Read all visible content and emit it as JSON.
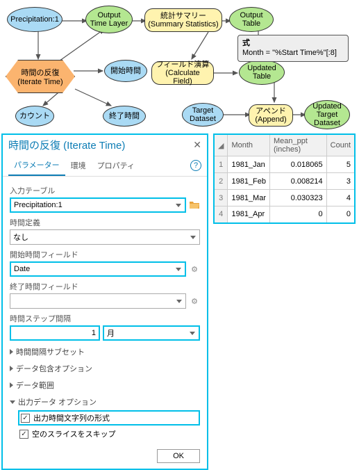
{
  "diagram": {
    "precipitation": "Precipitation:1",
    "output_time_layer": "Output Time Layer",
    "summary_stats": "統計サマリー (Summary Statistics)",
    "output_table": "Output Table",
    "iterate_hex": "時間の反復 (Iterate Time)",
    "start_time": "開始時間",
    "calc_field": "フィールド演算 (Calculate Field)",
    "updated_table": "Updated Table",
    "count": "カウント",
    "end_time": "終了時間",
    "target_dataset": "Target Dataset",
    "append": "アペンド (Append)",
    "updated_target": "Updated Target Dataset",
    "tooltip_title": "式",
    "tooltip_expr": "Month = \"%Start Time%\"[:8]"
  },
  "panel": {
    "title": "時間の反復 (Iterate Time)",
    "tabs": {
      "params": "パラメーター",
      "env": "環境",
      "props": "プロパティ"
    },
    "labels": {
      "input_table": "入力テーブル",
      "time_def": "時間定義",
      "start_field": "開始時間フィールド",
      "end_field": "終了時間フィールド",
      "step": "時間ステップ間隔"
    },
    "values": {
      "input_table": "Precipitation:1",
      "time_def": "なし",
      "start_field": "Date",
      "end_field": "",
      "step_num": "1",
      "step_unit": "月"
    },
    "sections": {
      "subset": "時間間隔サブセット",
      "inclusion": "データ包含オプション",
      "extent": "データ範囲",
      "output": "出力データ オプション"
    },
    "checks": {
      "out_format": "出力時間文字列の形式",
      "skip_empty": "空のスライスをスキップ"
    },
    "ok": "OK"
  },
  "table": {
    "headers": {
      "month": "Month",
      "mean": "Mean_ppt (inches)",
      "count": "Count"
    },
    "rows": [
      {
        "n": "1",
        "month": "1981_Jan",
        "mean": "0.018065",
        "count": "5"
      },
      {
        "n": "2",
        "month": "1981_Feb",
        "mean": "0.008214",
        "count": "3"
      },
      {
        "n": "3",
        "month": "1981_Mar",
        "mean": "0.030323",
        "count": "4"
      },
      {
        "n": "4",
        "month": "1981_Apr",
        "mean": "0",
        "count": "0"
      }
    ]
  }
}
